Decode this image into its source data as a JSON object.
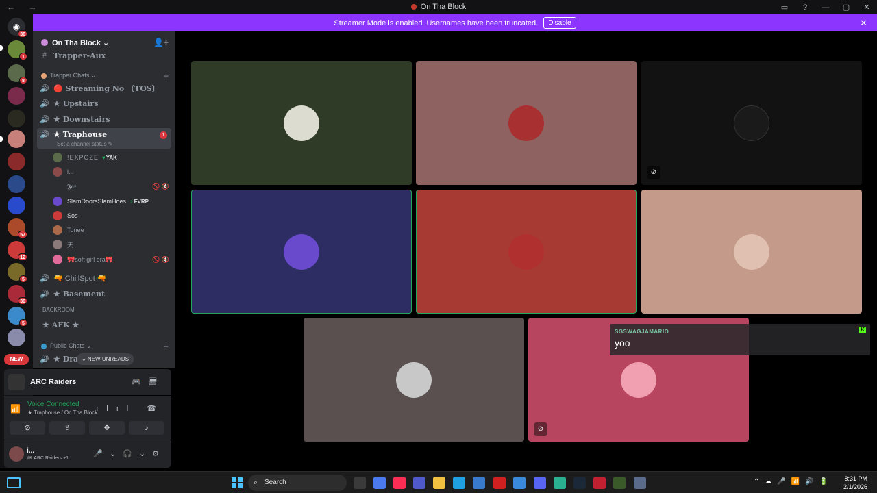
{
  "window": {
    "title": "On Tha Block",
    "nav": "← →"
  },
  "banner": {
    "text": "Streamer Mode is enabled. Usernames have been truncated.",
    "button": "Disable"
  },
  "rail": {
    "home_badge": "36",
    "badges": [
      "1",
      "8",
      "57",
      "12",
      "5",
      "30",
      "5"
    ],
    "new_label": "NEW"
  },
  "guild": {
    "name": "On Tha Block ⌄"
  },
  "channels": {
    "top_partial": "Trapper-Aux",
    "category1": "Trapper Chats ⌄",
    "streaming": "🔴 Streaming No 〔TOS〕",
    "upstairs": "★ Upstairs",
    "downstairs": "★ Downstairs",
    "traphouse": "★ Traphouse",
    "traphouse_status": "Set a channel status ✎",
    "traphouse_badge": "1",
    "chillspot": "🔫 ChillSpot 🔫",
    "basement": "★ Basement",
    "backroom": "BACKROOM",
    "afk": "★ AFK ★",
    "category2": "Public Chats ⌄",
    "drag": "★ Drag",
    "new_unreads": "⌄ NEW UNREADS"
  },
  "voice_users": [
    {
      "name": "!EXPOZE",
      "tag": "YAK",
      "tagicon": "♥"
    },
    {
      "name": "i..."
    },
    {
      "name": "𝕵𝖆𝖝"
    },
    {
      "name": "SlamDoorsSlamHoes",
      "tag": "FVRP",
      "tagicon": "⚡"
    },
    {
      "name": "Sos"
    },
    {
      "name": "Tonee"
    },
    {
      "name": "天"
    },
    {
      "name": "🎀soft girl era🎀"
    }
  ],
  "activity": {
    "name": "ARC Raiders"
  },
  "voice": {
    "status": "Voice Connected",
    "location": "★ Traphouse / On Tha Block"
  },
  "user": {
    "name": "i...",
    "status": "🎮 ARC Raiders +1"
  },
  "chat_popup": {
    "author": "SGSWAGJAMARIO",
    "message": "yoo"
  },
  "taskbar": {
    "search_placeholder": "Search",
    "time": "8:31 PM",
    "date": "2/1/2026"
  },
  "colors": {
    "accent": "#8b35ff",
    "speaking": "#23a55a",
    "badge": "#da373c"
  }
}
